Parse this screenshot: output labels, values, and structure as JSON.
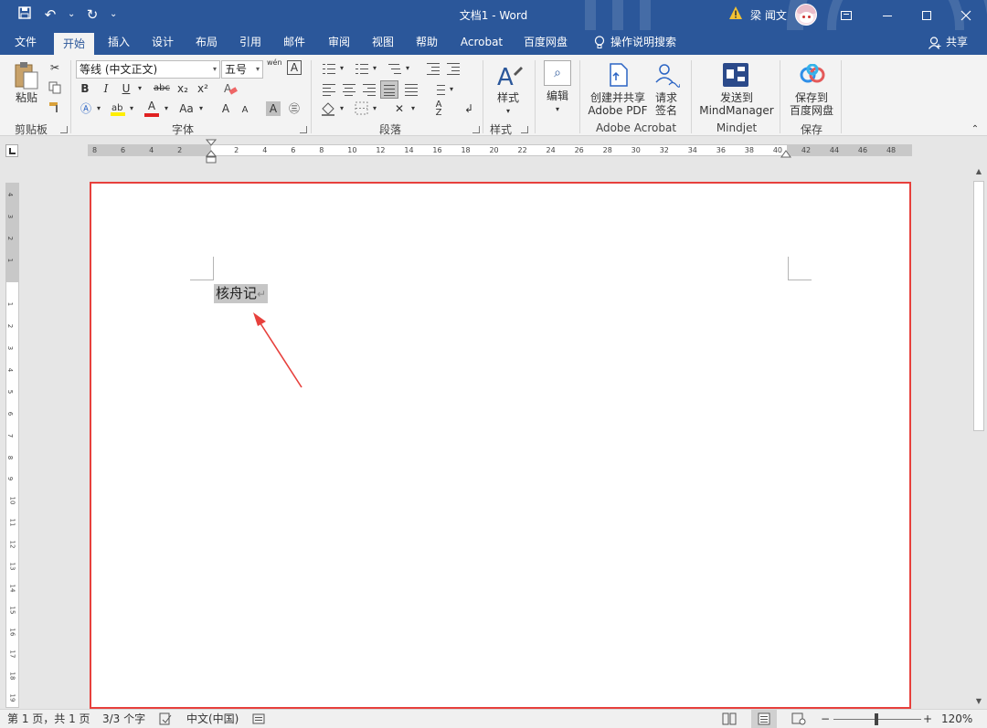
{
  "window": {
    "title": "文档1  -  Word",
    "user": "梁 闻文"
  },
  "tabs": [
    "文件",
    "开始",
    "插入",
    "设计",
    "布局",
    "引用",
    "邮件",
    "审阅",
    "视图",
    "帮助",
    "Acrobat",
    "百度网盘"
  ],
  "tell_me": "操作说明搜索",
  "share": "共享",
  "ribbon": {
    "clipboard": {
      "paste": "粘贴",
      "group": "剪贴板"
    },
    "font": {
      "font_name": "等线 (中文正文)",
      "font_size": "五号",
      "group": "字体",
      "bold": "B",
      "italic": "I",
      "underline": "U",
      "strike": "abc",
      "subscript": "x₂",
      "superscript": "x²",
      "font_color": "A",
      "case": "Aa",
      "grow": "A",
      "shrink": "A",
      "char_shade": "A",
      "phonetic": "wén",
      "border": "A"
    },
    "paragraph": {
      "group": "段落"
    },
    "styles": {
      "label": "样式",
      "group": "样式"
    },
    "editing": {
      "label": "编辑"
    },
    "acrobat": {
      "create_l1": "创建并共享",
      "create_l2": "Adobe PDF",
      "sign_l1": "请求",
      "sign_l2": "签名",
      "group": "Adobe Acrobat"
    },
    "mindjet": {
      "send_l1": "发送到",
      "send_l2": "MindManager",
      "group": "Mindjet"
    },
    "save": {
      "label_l1": "保存到",
      "label_l2": "百度网盘",
      "group": "保存"
    }
  },
  "hruler_numbers": [
    "8",
    "6",
    "4",
    "2",
    "",
    "2",
    "4",
    "6",
    "8",
    "10",
    "12",
    "14",
    "16",
    "18",
    "20",
    "22",
    "24",
    "26",
    "28",
    "30",
    "32",
    "34",
    "36",
    "38",
    "40",
    "42",
    "44",
    "46",
    "48"
  ],
  "vruler_numbers": [
    "4",
    "3",
    "2",
    "1",
    "",
    "1",
    "2",
    "3",
    "4",
    "5",
    "6",
    "7",
    "8",
    "9",
    "10",
    "11",
    "12",
    "13",
    "14",
    "15",
    "16",
    "17",
    "18",
    "19"
  ],
  "document": {
    "text": "核舟记",
    "para_mark": "↵"
  },
  "status": {
    "page": "第 1 页，共 1 页",
    "words": "3/3 个字",
    "language": "中文(中国)",
    "zoom": "120%",
    "zoom_minus": "−",
    "zoom_plus": "+"
  }
}
